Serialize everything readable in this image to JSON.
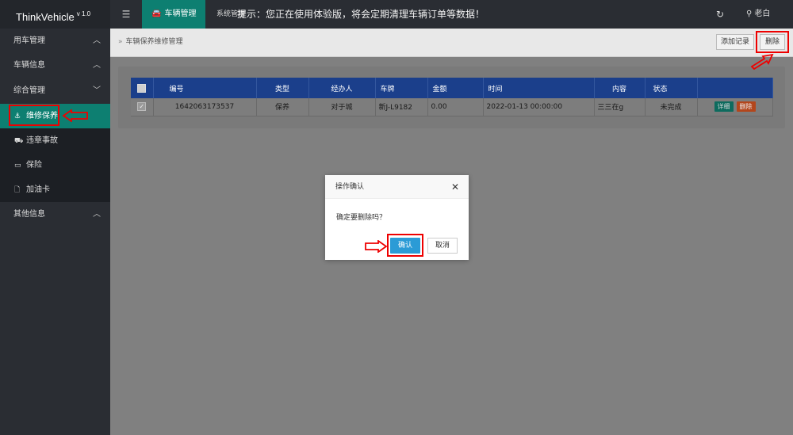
{
  "header": {
    "logo": "ThinkVehicle",
    "version": "v 1.0",
    "menu_icon": "hamburger-icon",
    "active_tab": "车辆管理",
    "system_tab": "系统管理",
    "notice": "提示：您正在使用体验版，将会定期清理车辆订单等数据！",
    "refresh_icon": "refresh-icon",
    "user": "老白"
  },
  "sidebar": {
    "groups": [
      {
        "label": "用车管理",
        "chevron": "up"
      },
      {
        "label": "车辆信息",
        "chevron": "up"
      },
      {
        "label": "综合管理",
        "chevron": "down"
      }
    ],
    "subitems": [
      {
        "label": "维修保养",
        "icon": "anchor-icon",
        "active": true
      },
      {
        "label": "违章事故",
        "icon": "truck-icon",
        "active": false
      },
      {
        "label": "保险",
        "icon": "card-icon",
        "active": false
      },
      {
        "label": "加油卡",
        "icon": "file-icon",
        "active": false
      }
    ],
    "other": {
      "label": "其他信息",
      "chevron": "up"
    }
  },
  "breadcrumb": "车辆保养维修管理",
  "toolbar": {
    "add_label": "添加记录",
    "delete_label": "删除"
  },
  "table": {
    "columns": [
      "编号",
      "类型",
      "经办人",
      "车牌",
      "金额",
      "时间",
      "内容",
      "状态"
    ],
    "rows": [
      {
        "id": "1642063173537",
        "type": "保养",
        "handler": "对于城",
        "plate": "新J-L9182",
        "amount": "0.00",
        "time": "2022-01-13 00:00:00",
        "content": "三三在g",
        "status": "未完成",
        "detail_label": "详细",
        "delete_label": "删除"
      }
    ]
  },
  "dialog": {
    "title": "操作确认",
    "message": "确定要删除吗？",
    "ok_label": "确认",
    "cancel_label": "取消"
  },
  "colors": {
    "accent": "#0d7f71",
    "table_header": "#1b3f8b",
    "ok_button": "#2b9bd6",
    "annotation": "#ee0000"
  }
}
